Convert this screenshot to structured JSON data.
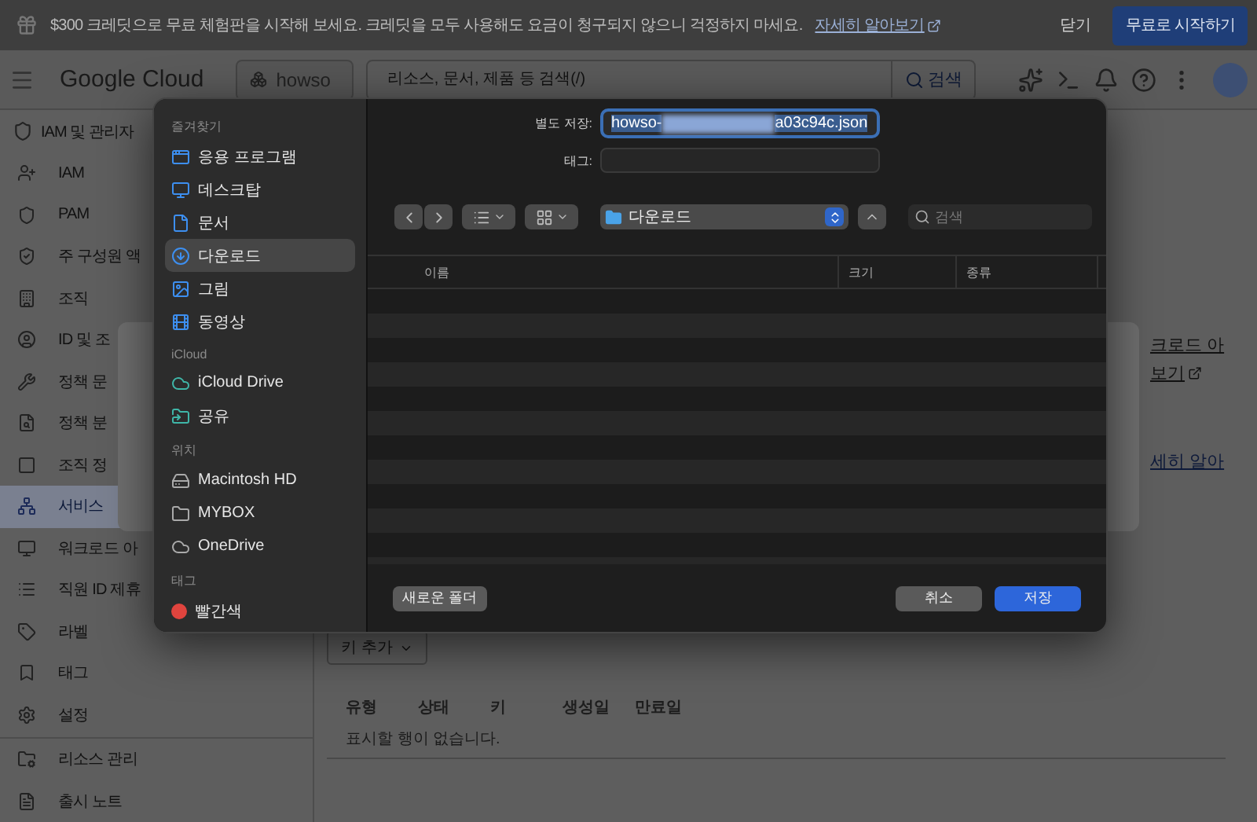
{
  "banner": {
    "text": "$300 크레딧으로 무료 체험판을 시작해 보세요. 크레딧을 모두 사용해도 요금이 청구되지 않으니 걱정하지 마세요.",
    "link": "자세히 알아보기",
    "close": "닫기",
    "cta": "무료로 시작하기"
  },
  "header": {
    "logo": "Google Cloud",
    "project": "howso",
    "search": {
      "placeholder": "리소스, 문서, 제품 등 검색(/)",
      "button": "검색"
    }
  },
  "nav": {
    "title": "IAM 및 관리자",
    "items": [
      {
        "label": "IAM",
        "selected": false
      },
      {
        "label": "PAM",
        "selected": false
      },
      {
        "label": "주 구성원 액",
        "selected": false
      },
      {
        "label": "조직",
        "selected": false
      },
      {
        "label": "ID 및 조",
        "selected": false
      },
      {
        "label": "정책 문",
        "selected": false
      },
      {
        "label": "정책 분",
        "selected": false
      },
      {
        "label": "조직 정",
        "selected": false
      },
      {
        "label": "서비스",
        "selected": true
      },
      {
        "label": "워크로드 아",
        "selected": false
      },
      {
        "label": "직원 ID 제휴",
        "selected": false
      },
      {
        "label": "라벨",
        "selected": false
      },
      {
        "label": "태그",
        "selected": false
      },
      {
        "label": "설정",
        "selected": false
      }
    ],
    "footer": [
      "리소스 관리",
      "출시 노트"
    ]
  },
  "content": {
    "links": [
      "크로드 아",
      "보기",
      "세히 알아"
    ],
    "add_key": "키 추가",
    "table": {
      "columns": [
        "유형",
        "상태",
        "키",
        "생성일",
        "만료일"
      ],
      "empty": "표시할 행이 없습니다."
    }
  },
  "save_dialog": {
    "sidebar": [
      {
        "title": "즐겨찾기",
        "items": [
          {
            "label": "응용 프로그램",
            "selected": false
          },
          {
            "label": "데스크탑",
            "selected": false
          },
          {
            "label": "문서",
            "selected": false
          },
          {
            "label": "다운로드",
            "selected": true
          },
          {
            "label": "그림",
            "selected": false
          },
          {
            "label": "동영상",
            "selected": false
          }
        ]
      },
      {
        "title": "iCloud",
        "items": [
          {
            "label": "iCloud Drive",
            "selected": false
          },
          {
            "label": "공유",
            "selected": false
          }
        ]
      },
      {
        "title": "위치",
        "items": [
          {
            "label": "Macintosh HD",
            "selected": false
          },
          {
            "label": "MYBOX",
            "selected": false
          },
          {
            "label": "OneDrive",
            "selected": false
          }
        ]
      },
      {
        "title": "태그",
        "items": [
          {
            "label": "빨간색",
            "selected": false,
            "color": "#e0443e"
          }
        ]
      }
    ],
    "save_as_label": "별도 저장:",
    "filename": {
      "prefix": "howso-",
      "suffix": "a03c94c.json"
    },
    "tags_label": "태그:",
    "location": "다운로드",
    "search_placeholder": "검색",
    "columns": [
      "이름",
      "크기",
      "종류"
    ],
    "buttons": {
      "new_folder": "새로운 폴더",
      "cancel": "취소",
      "save": "저장"
    }
  }
}
